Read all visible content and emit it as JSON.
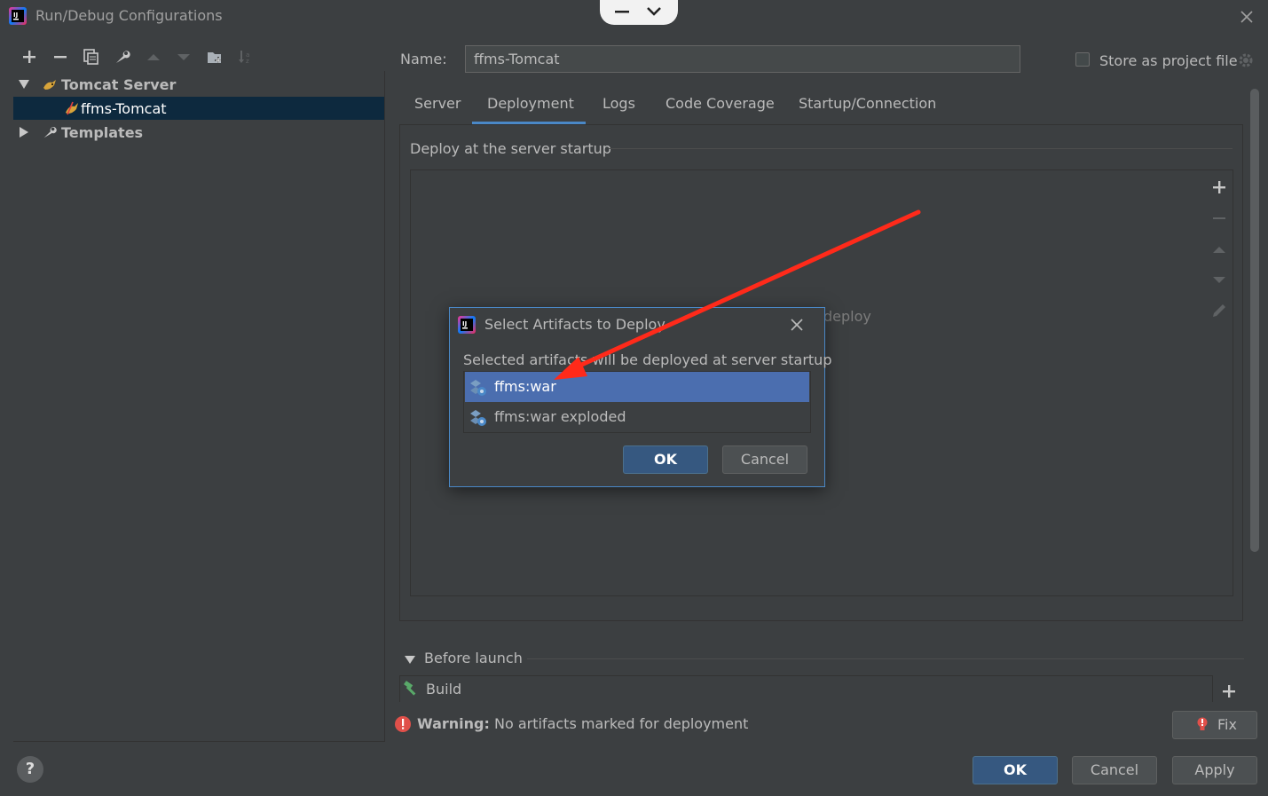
{
  "window": {
    "title": "Run/Debug Configurations"
  },
  "tree": {
    "items": [
      {
        "label": "Tomcat Server",
        "level": 0,
        "expanded": true
      },
      {
        "label": "ffms-Tomcat",
        "level": 1,
        "selected": true
      },
      {
        "label": "Templates",
        "level": 0,
        "expanded": false
      }
    ]
  },
  "form": {
    "name_label": "Name:",
    "name_value": "ffms-Tomcat",
    "store_label": "Store as project file",
    "store_checked": false
  },
  "tabs": [
    {
      "label": "Server",
      "active": false
    },
    {
      "label": "Deployment",
      "active": true
    },
    {
      "label": "Logs",
      "active": false
    },
    {
      "label": "Code Coverage",
      "active": false
    },
    {
      "label": "Startup/Connection",
      "active": false
    }
  ],
  "deployment": {
    "section_title": "Deploy at the server startup",
    "empty_text_fragment": "deploy"
  },
  "before_launch": {
    "label": "Before launch",
    "items": [
      "Build"
    ]
  },
  "warning": {
    "prefix": "Warning:",
    "message": "No artifacts marked for deployment",
    "fix_label": "Fix"
  },
  "footer": {
    "ok_label": "OK",
    "cancel_label": "Cancel",
    "apply_label": "Apply",
    "help_label": "?"
  },
  "modal": {
    "title": "Select Artifacts to Deploy",
    "description": "Selected artifacts will be deployed at server startup",
    "artifacts": [
      {
        "label": "ffms:war",
        "selected": true
      },
      {
        "label": "ffms:war exploded",
        "selected": false
      }
    ],
    "ok_label": "OK",
    "cancel_label": "Cancel"
  },
  "colors": {
    "background": "#3c3f41",
    "selection_tree": "#0d293e",
    "selection_list": "#4b6eaf",
    "accent": "#4a88c7",
    "primary_button": "#365880",
    "annotation_arrow": "#ff2a1a",
    "warning": "#e0504a"
  }
}
